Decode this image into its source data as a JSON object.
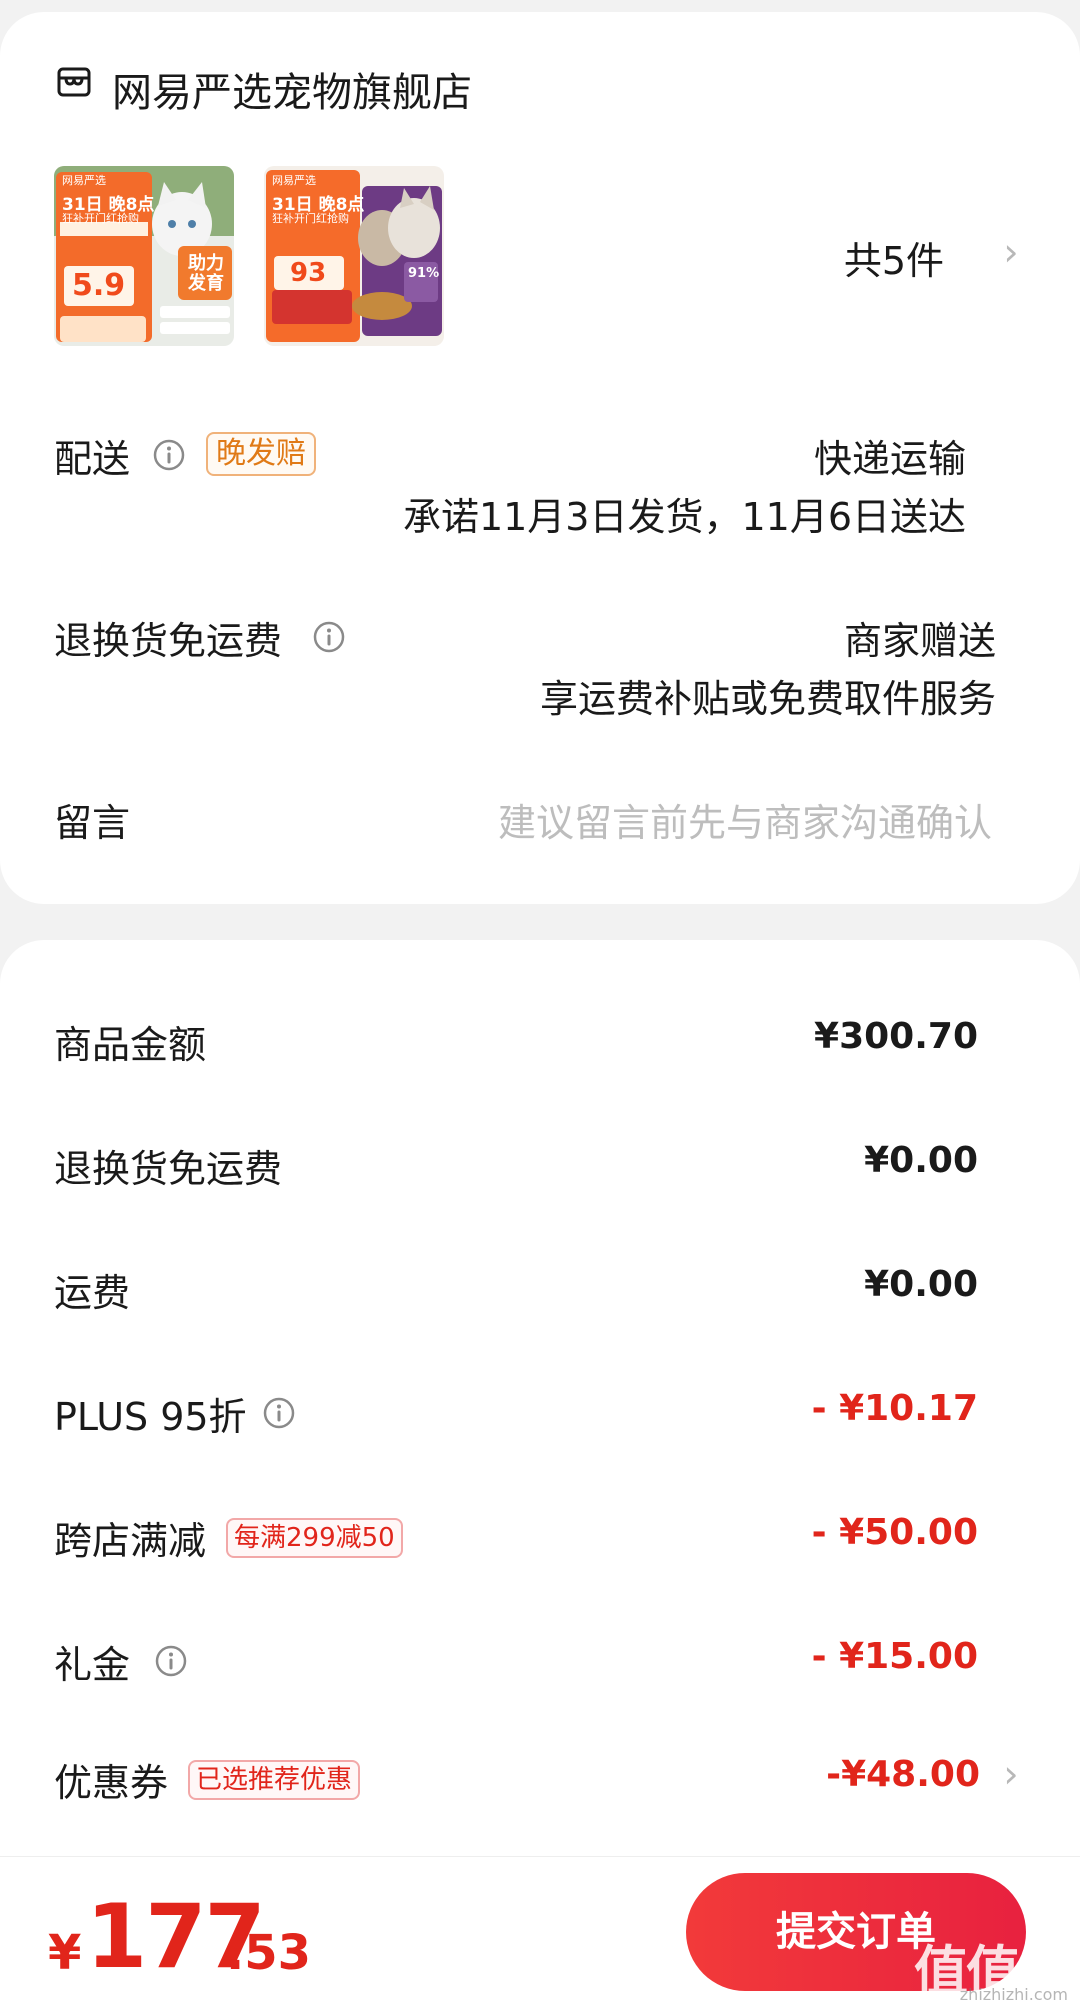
{
  "shop": {
    "name": "网易严选宠物旗舰店",
    "item_count": "共5件",
    "products": [
      {
        "badge": "31日 晚8点",
        "promo": "狂补开门红抢购",
        "price": "5.9",
        "slogan": "助力发育",
        "brand": "网易严选"
      },
      {
        "badge": "31日 晚8点",
        "promo": "狂补开门红抢购",
        "price": "93",
        "percent": "91%",
        "brand": "网易严选"
      }
    ],
    "delivery": {
      "label": "配送",
      "tag": "晚发赔",
      "method": "快递运输",
      "promise": "承诺11月3日发货，11月6日送达"
    },
    "return_shipping": {
      "label": "退换货免运费",
      "value_line1": "商家赠送",
      "value_line2": "享运费补贴或免费取件服务"
    },
    "message": {
      "label": "留言",
      "placeholder": "建议留言前先与商家沟通确认"
    }
  },
  "price_detail": {
    "goods_amount": {
      "label": "商品金额",
      "value": "¥300.70"
    },
    "return_fee": {
      "label": "退换货免运费",
      "value": "¥0.00"
    },
    "shipping": {
      "label": "运费",
      "value": "¥0.00"
    },
    "plus": {
      "label": "PLUS 95折",
      "value": "- ¥10.17"
    },
    "cross_store": {
      "label": "跨店满减",
      "tag": "每满299减50",
      "value": "- ¥50.00"
    },
    "gift_money": {
      "label": "礼金",
      "value": "- ¥15.00"
    },
    "coupon": {
      "label": "优惠券",
      "tag": "已选推荐优惠",
      "value": "-¥48.00"
    }
  },
  "bottom": {
    "currency": "¥",
    "total_int": "177",
    "total_dec": ".53",
    "submit_label": "提交订单",
    "watermark": "值值值",
    "watermark_sub": "zhizhizhi.com"
  },
  "colors": {
    "accent_red": "#e1251b",
    "tag_orange": "#e07a17",
    "placeholder": "#bdbdbd"
  },
  "icons": [
    "shop-icon",
    "info-icon",
    "chevron-right-icon"
  ]
}
